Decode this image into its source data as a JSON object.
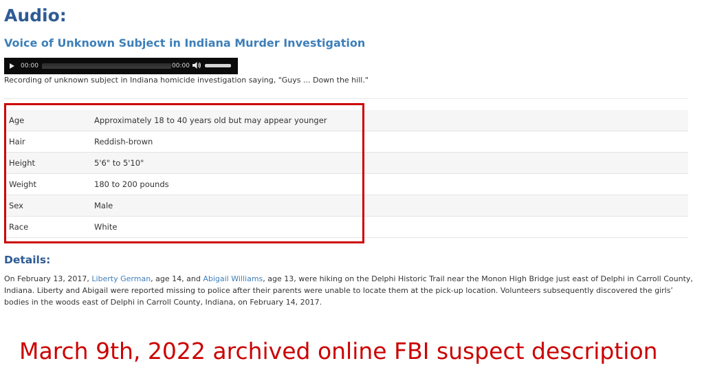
{
  "heading": "Audio:",
  "audio": {
    "title": "Voice of Unknown Subject in Indiana Murder Investigation",
    "current_time": "00:00",
    "duration": "00:00",
    "volume": 1.0,
    "progress": 0,
    "caption": "Recording of unknown subject in Indiana homicide investigation saying, \"Guys ... Down the hill.\""
  },
  "description": {
    "rows": [
      {
        "label": "Age",
        "value": "Approximately 18 to 40 years old but may appear younger"
      },
      {
        "label": "Hair",
        "value": "Reddish-brown"
      },
      {
        "label": "Height",
        "value": "5'6\" to 5'10\""
      },
      {
        "label": "Weight",
        "value": "180 to 200 pounds"
      },
      {
        "label": "Sex",
        "value": "Male"
      },
      {
        "label": "Race",
        "value": "White"
      }
    ]
  },
  "details": {
    "heading": "Details:",
    "p1": "On February 13, 2017, ",
    "link1": "Liberty German",
    "p2": ", age 14, and ",
    "link2": "Abigail Williams",
    "p3": ", age 13, were hiking on the Delphi Historic Trail near the Monon High Bridge just east of Delphi in Carroll County, Indiana.  Liberty and Abigail were reported missing to police after their parents were unable to locate them at the pick-up location.  Volunteers subsequently discovered the girls’ bodies in the woods east of Delphi in Carroll County, Indiana, on February 14, 2017."
  },
  "annotation": "March 9th, 2022 archived online FBI suspect description",
  "colors": {
    "heading": "#2e5b94",
    "subheading": "#3d7fb9",
    "link": "#3d7fb9",
    "annotation": "#cc0000"
  }
}
